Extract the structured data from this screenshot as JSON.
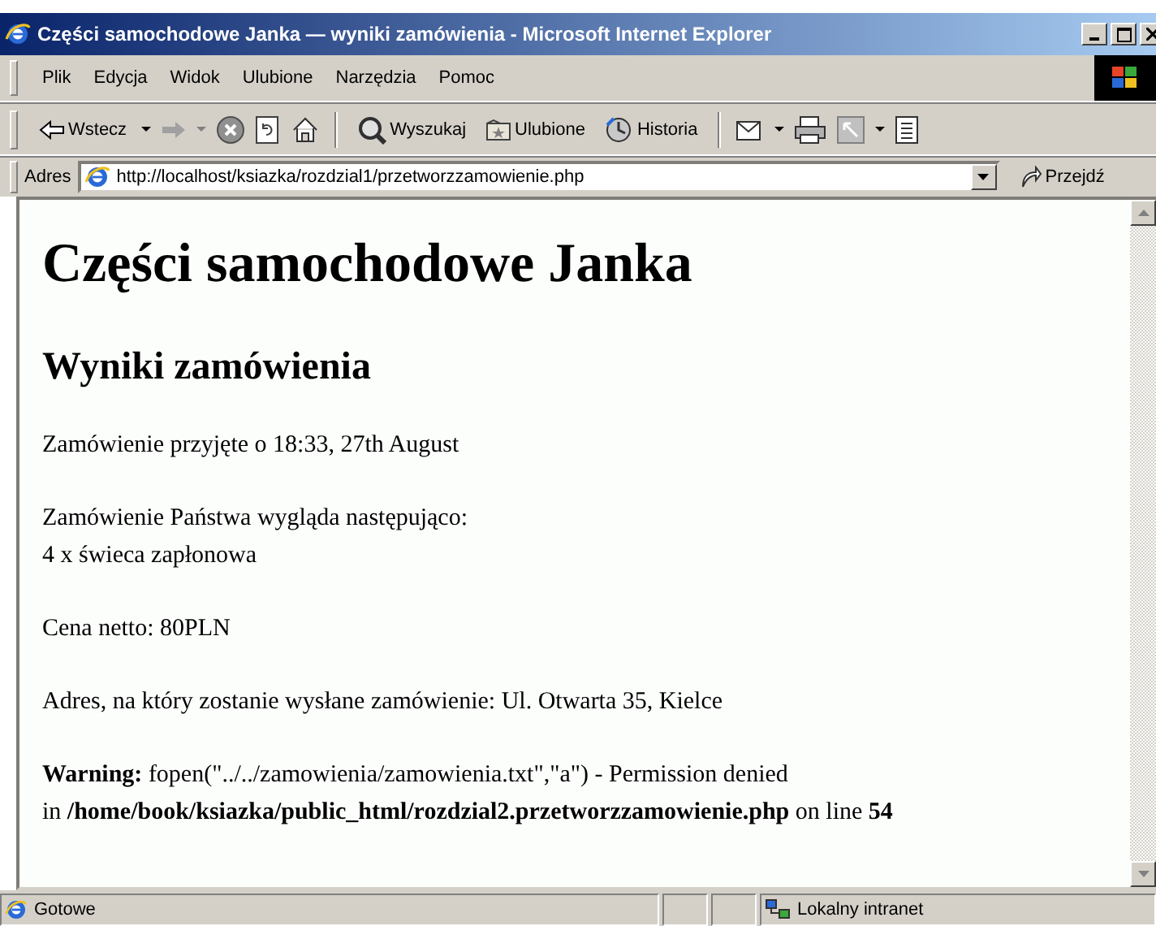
{
  "window": {
    "title": "Części samochodowe Janka — wyniki zamówienia - Microsoft Internet Explorer"
  },
  "menu": [
    "Plik",
    "Edycja",
    "Widok",
    "Ulubione",
    "Narzędzia",
    "Pomoc"
  ],
  "toolbar": {
    "buttons": [
      "Wstecz",
      "Wyszukaj",
      "Ulubione",
      "Historia"
    ]
  },
  "address": {
    "label": "Adres",
    "url": "http://localhost/ksiazka/rozdzial1/przetworzzamowienie.php",
    "go": "Przejdź"
  },
  "page": {
    "heading": "Części samochodowe Janka",
    "subheading": "Wyniki zamówienia",
    "paragraphs": [
      {
        "lines": [
          "Zamówienie przyjęte o 18:33, 27th August"
        ]
      },
      {
        "lines": [
          "Zamówienie Państwa wygląda następująco:",
          "4 x świeca zapłonowa"
        ]
      },
      {
        "lines": [
          "Cena netto: 80PLN"
        ]
      },
      {
        "lines": [
          "Adres, na który zostanie wysłane zamówienie: Ul. Otwarta 35, Kielce"
        ]
      },
      {
        "lines": [
          "**Warning:** fopen(\"../../zamowienia/zamowienia.txt\",\"a\") - Permission denied",
          "in **/home/book/ksiazka/public_html/rozdzial2.przetworzzamowienie.php** on line **54**"
        ]
      }
    ]
  },
  "status_bar": {
    "text": "Gotowe",
    "zone": "Lokalny intranet"
  }
}
